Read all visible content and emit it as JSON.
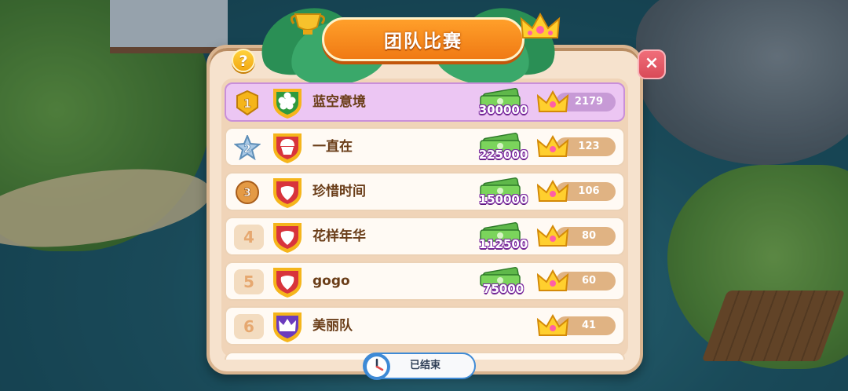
{
  "title": "团队比赛",
  "help_label": "?",
  "close_label": "×",
  "status_label": "已结束",
  "colors": {
    "banner": "#f07a14",
    "highlight_row": "#ecc6f3",
    "shield_red": "#d8343c",
    "shield_green": "#2f9a3e",
    "shield_purple": "#6b3bbd",
    "gold": "#f5b51b"
  },
  "teams": [
    {
      "rank": "1",
      "rank_style": "gold-badge",
      "name": "蓝空意境",
      "emblem": "flower-icon",
      "reward": "300000",
      "score": "2179"
    },
    {
      "rank": "2",
      "rank_style": "silver-star",
      "name": "一直在",
      "emblem": "cupcake-icon",
      "reward": "225000",
      "score": "123"
    },
    {
      "rank": "3",
      "rank_style": "bronze-medal",
      "name": "珍惜时间",
      "emblem": "strawberry-icon",
      "reward": "150000",
      "score": "106"
    },
    {
      "rank": "4",
      "rank_style": "plain",
      "name": "花样年华",
      "emblem": "strawberry-icon",
      "reward": "112500",
      "score": "80"
    },
    {
      "rank": "5",
      "rank_style": "plain",
      "name": "gogo",
      "emblem": "strawberry-icon",
      "reward": "75000",
      "score": "60"
    },
    {
      "rank": "6",
      "rank_style": "plain",
      "name": "美丽队",
      "emblem": "crown-icon",
      "reward": "",
      "score": "41"
    }
  ]
}
